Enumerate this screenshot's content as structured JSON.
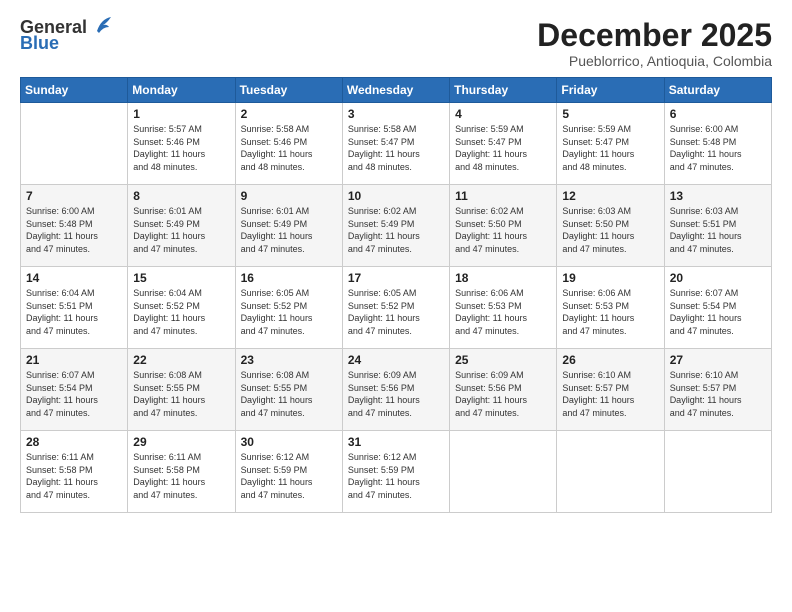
{
  "logo": {
    "general": "General",
    "blue": "Blue"
  },
  "header": {
    "month": "December 2025",
    "location": "Pueblorrico, Antioquia, Colombia"
  },
  "days_of_week": [
    "Sunday",
    "Monday",
    "Tuesday",
    "Wednesday",
    "Thursday",
    "Friday",
    "Saturday"
  ],
  "weeks": [
    [
      {
        "day": "",
        "data": ""
      },
      {
        "day": "1",
        "data": "Sunrise: 5:57 AM\nSunset: 5:46 PM\nDaylight: 11 hours\nand 48 minutes."
      },
      {
        "day": "2",
        "data": "Sunrise: 5:58 AM\nSunset: 5:46 PM\nDaylight: 11 hours\nand 48 minutes."
      },
      {
        "day": "3",
        "data": "Sunrise: 5:58 AM\nSunset: 5:47 PM\nDaylight: 11 hours\nand 48 minutes."
      },
      {
        "day": "4",
        "data": "Sunrise: 5:59 AM\nSunset: 5:47 PM\nDaylight: 11 hours\nand 48 minutes."
      },
      {
        "day": "5",
        "data": "Sunrise: 5:59 AM\nSunset: 5:47 PM\nDaylight: 11 hours\nand 48 minutes."
      },
      {
        "day": "6",
        "data": "Sunrise: 6:00 AM\nSunset: 5:48 PM\nDaylight: 11 hours\nand 47 minutes."
      }
    ],
    [
      {
        "day": "7",
        "data": "Sunrise: 6:00 AM\nSunset: 5:48 PM\nDaylight: 11 hours\nand 47 minutes."
      },
      {
        "day": "8",
        "data": "Sunrise: 6:01 AM\nSunset: 5:49 PM\nDaylight: 11 hours\nand 47 minutes."
      },
      {
        "day": "9",
        "data": "Sunrise: 6:01 AM\nSunset: 5:49 PM\nDaylight: 11 hours\nand 47 minutes."
      },
      {
        "day": "10",
        "data": "Sunrise: 6:02 AM\nSunset: 5:49 PM\nDaylight: 11 hours\nand 47 minutes."
      },
      {
        "day": "11",
        "data": "Sunrise: 6:02 AM\nSunset: 5:50 PM\nDaylight: 11 hours\nand 47 minutes."
      },
      {
        "day": "12",
        "data": "Sunrise: 6:03 AM\nSunset: 5:50 PM\nDaylight: 11 hours\nand 47 minutes."
      },
      {
        "day": "13",
        "data": "Sunrise: 6:03 AM\nSunset: 5:51 PM\nDaylight: 11 hours\nand 47 minutes."
      }
    ],
    [
      {
        "day": "14",
        "data": "Sunrise: 6:04 AM\nSunset: 5:51 PM\nDaylight: 11 hours\nand 47 minutes."
      },
      {
        "day": "15",
        "data": "Sunrise: 6:04 AM\nSunset: 5:52 PM\nDaylight: 11 hours\nand 47 minutes."
      },
      {
        "day": "16",
        "data": "Sunrise: 6:05 AM\nSunset: 5:52 PM\nDaylight: 11 hours\nand 47 minutes."
      },
      {
        "day": "17",
        "data": "Sunrise: 6:05 AM\nSunset: 5:52 PM\nDaylight: 11 hours\nand 47 minutes."
      },
      {
        "day": "18",
        "data": "Sunrise: 6:06 AM\nSunset: 5:53 PM\nDaylight: 11 hours\nand 47 minutes."
      },
      {
        "day": "19",
        "data": "Sunrise: 6:06 AM\nSunset: 5:53 PM\nDaylight: 11 hours\nand 47 minutes."
      },
      {
        "day": "20",
        "data": "Sunrise: 6:07 AM\nSunset: 5:54 PM\nDaylight: 11 hours\nand 47 minutes."
      }
    ],
    [
      {
        "day": "21",
        "data": "Sunrise: 6:07 AM\nSunset: 5:54 PM\nDaylight: 11 hours\nand 47 minutes."
      },
      {
        "day": "22",
        "data": "Sunrise: 6:08 AM\nSunset: 5:55 PM\nDaylight: 11 hours\nand 47 minutes."
      },
      {
        "day": "23",
        "data": "Sunrise: 6:08 AM\nSunset: 5:55 PM\nDaylight: 11 hours\nand 47 minutes."
      },
      {
        "day": "24",
        "data": "Sunrise: 6:09 AM\nSunset: 5:56 PM\nDaylight: 11 hours\nand 47 minutes."
      },
      {
        "day": "25",
        "data": "Sunrise: 6:09 AM\nSunset: 5:56 PM\nDaylight: 11 hours\nand 47 minutes."
      },
      {
        "day": "26",
        "data": "Sunrise: 6:10 AM\nSunset: 5:57 PM\nDaylight: 11 hours\nand 47 minutes."
      },
      {
        "day": "27",
        "data": "Sunrise: 6:10 AM\nSunset: 5:57 PM\nDaylight: 11 hours\nand 47 minutes."
      }
    ],
    [
      {
        "day": "28",
        "data": "Sunrise: 6:11 AM\nSunset: 5:58 PM\nDaylight: 11 hours\nand 47 minutes."
      },
      {
        "day": "29",
        "data": "Sunrise: 6:11 AM\nSunset: 5:58 PM\nDaylight: 11 hours\nand 47 minutes."
      },
      {
        "day": "30",
        "data": "Sunrise: 6:12 AM\nSunset: 5:59 PM\nDaylight: 11 hours\nand 47 minutes."
      },
      {
        "day": "31",
        "data": "Sunrise: 6:12 AM\nSunset: 5:59 PM\nDaylight: 11 hours\nand 47 minutes."
      },
      {
        "day": "",
        "data": ""
      },
      {
        "day": "",
        "data": ""
      },
      {
        "day": "",
        "data": ""
      }
    ]
  ]
}
